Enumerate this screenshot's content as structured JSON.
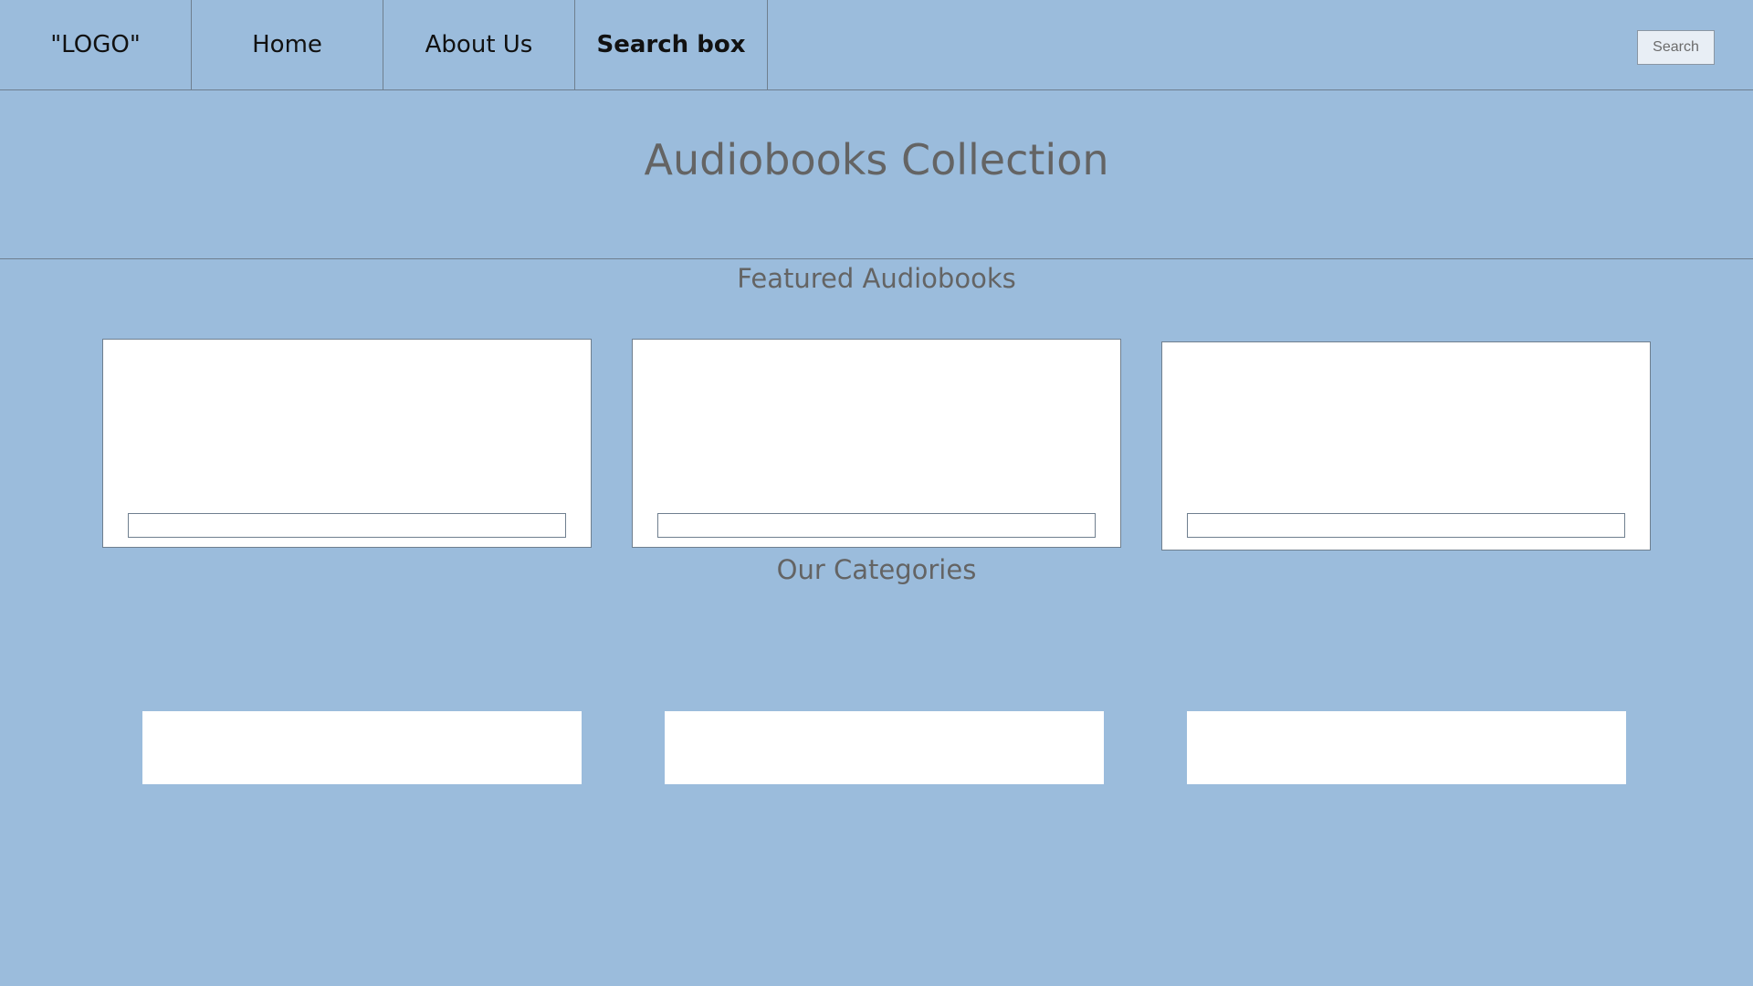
{
  "nav": {
    "logo": "\"LOGO\"",
    "items": [
      {
        "label": "Home"
      },
      {
        "label": "About Us"
      },
      {
        "label": "Search box"
      }
    ],
    "search_button": "Search"
  },
  "hero": {
    "title": "Audiobooks Collection"
  },
  "featured": {
    "title": "Featured Audiobooks",
    "cards": [
      {
        "field_value": ""
      },
      {
        "field_value": ""
      },
      {
        "field_value": ""
      }
    ]
  },
  "categories": {
    "title": "Our Categories",
    "tiles": [
      {
        "label": ""
      },
      {
        "label": ""
      },
      {
        "label": ""
      }
    ]
  },
  "colors": {
    "background": "#9bbcdc",
    "border": "#6f7f8f",
    "heading_text": "#646464",
    "card": "#ffffff"
  }
}
